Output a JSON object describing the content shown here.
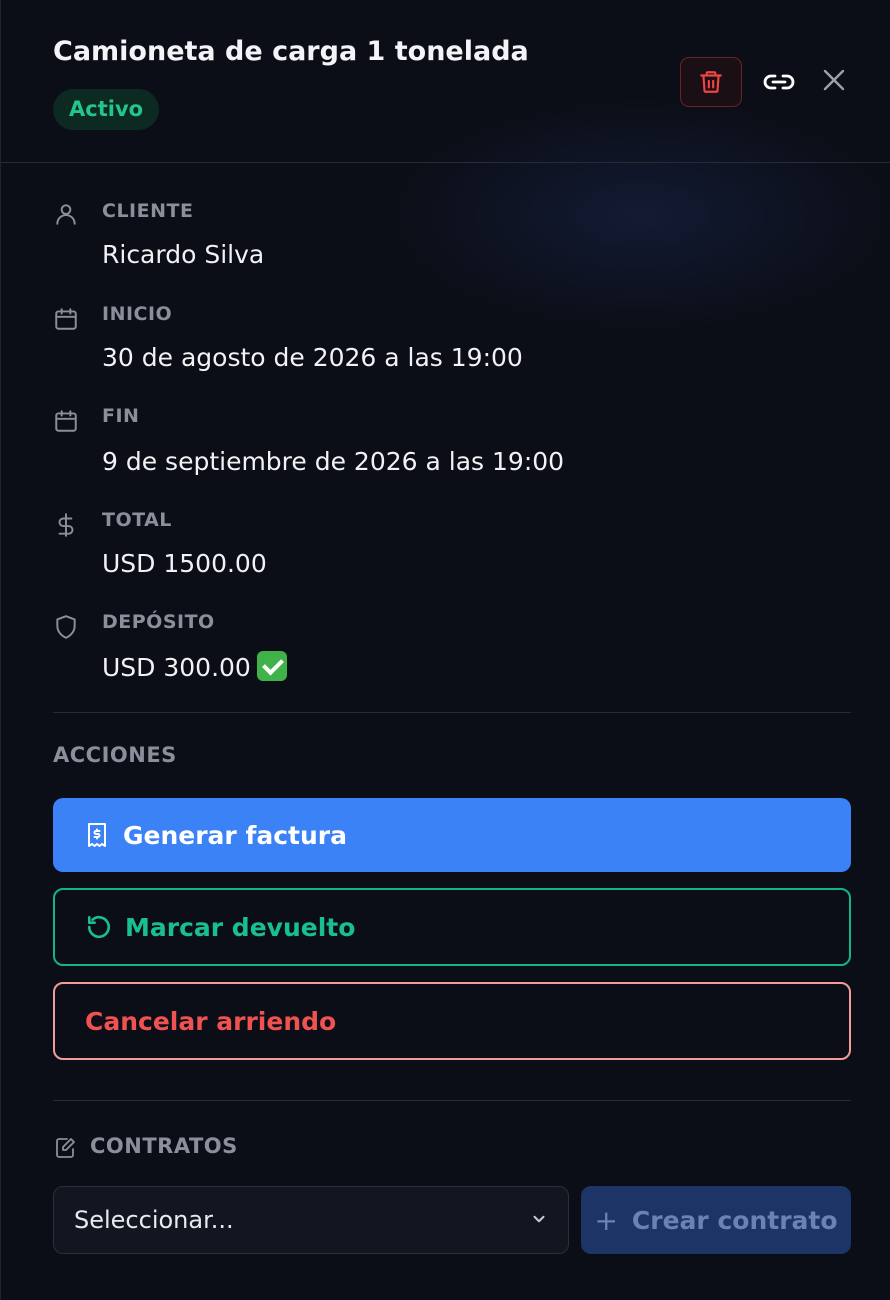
{
  "header": {
    "title": "Camioneta de carga 1 tonelada",
    "status": "Activo"
  },
  "fields": [
    {
      "label": "CLIENTE",
      "value": "Ricardo Silva",
      "icon": "user-icon"
    },
    {
      "label": "INICIO",
      "value": "30 de agosto de 2026 a las 19:00",
      "icon": "calendar-icon"
    },
    {
      "label": "FIN",
      "value": "9 de septiembre de 2026 a las 19:00",
      "icon": "calendar-icon"
    },
    {
      "label": "TOTAL",
      "value": "USD 1500.00",
      "icon": "dollar-icon"
    },
    {
      "label": "DEPÓSITO",
      "value": "USD 300.00",
      "icon": "shield-icon",
      "paid": true
    }
  ],
  "actions": {
    "label": "ACCIONES",
    "invoice": "Generar factura",
    "returned": "Marcar devuelto",
    "cancel": "Cancelar arriendo"
  },
  "contracts": {
    "label": "CONTRATOS",
    "select_placeholder": "Seleccionar...",
    "create": "Crear contrato"
  },
  "colors": {
    "primary": "#3b82f6",
    "success": "#19c08f",
    "danger": "#f05252",
    "background": "#0b0e16"
  }
}
